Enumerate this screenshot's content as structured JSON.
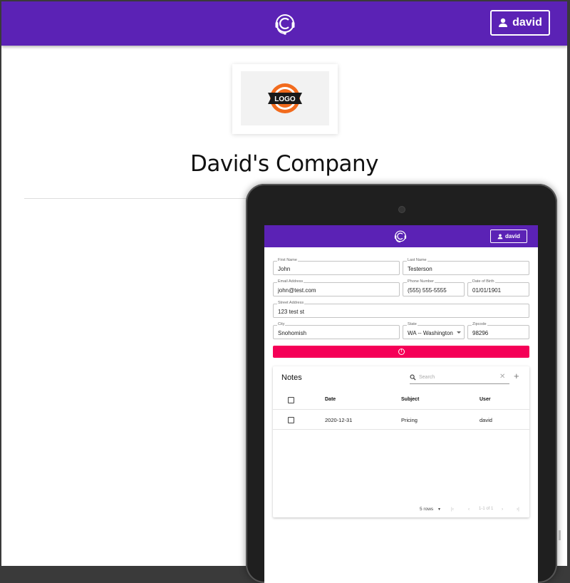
{
  "app": {
    "user_button_label": "david"
  },
  "company": {
    "name": "David's Company",
    "logo_text": "LOGO"
  },
  "colors": {
    "brand": "#5b22b5",
    "alert": "#f50057"
  },
  "tablet": {
    "user_button_label": "david",
    "form": {
      "first_name": {
        "label": "First Name",
        "value": "John"
      },
      "last_name": {
        "label": "Last Name",
        "value": "Testerson"
      },
      "email": {
        "label": "Email Address",
        "value": "john@test.com"
      },
      "phone": {
        "label": "Phone Number",
        "value": "(555) 555-5555"
      },
      "dob": {
        "label": "Date of Birth",
        "value": "01/01/1901"
      },
      "street": {
        "label": "Street Address",
        "value": "123 test st"
      },
      "city": {
        "label": "City",
        "value": "Snohomish"
      },
      "state": {
        "label": "State",
        "value": "WA -- Washington"
      },
      "zipcode": {
        "label": "Zipcode",
        "value": "98296"
      }
    },
    "alert_icon": "!",
    "notes": {
      "title": "Notes",
      "search_placeholder": "Search",
      "columns": [
        "Date",
        "Subject",
        "User"
      ],
      "rows": [
        {
          "date": "2020-12-31",
          "subject": "Pricing",
          "user": "david"
        }
      ],
      "pagination": {
        "rows_per_page": "5 rows",
        "range": "1-1 of 1"
      }
    }
  }
}
